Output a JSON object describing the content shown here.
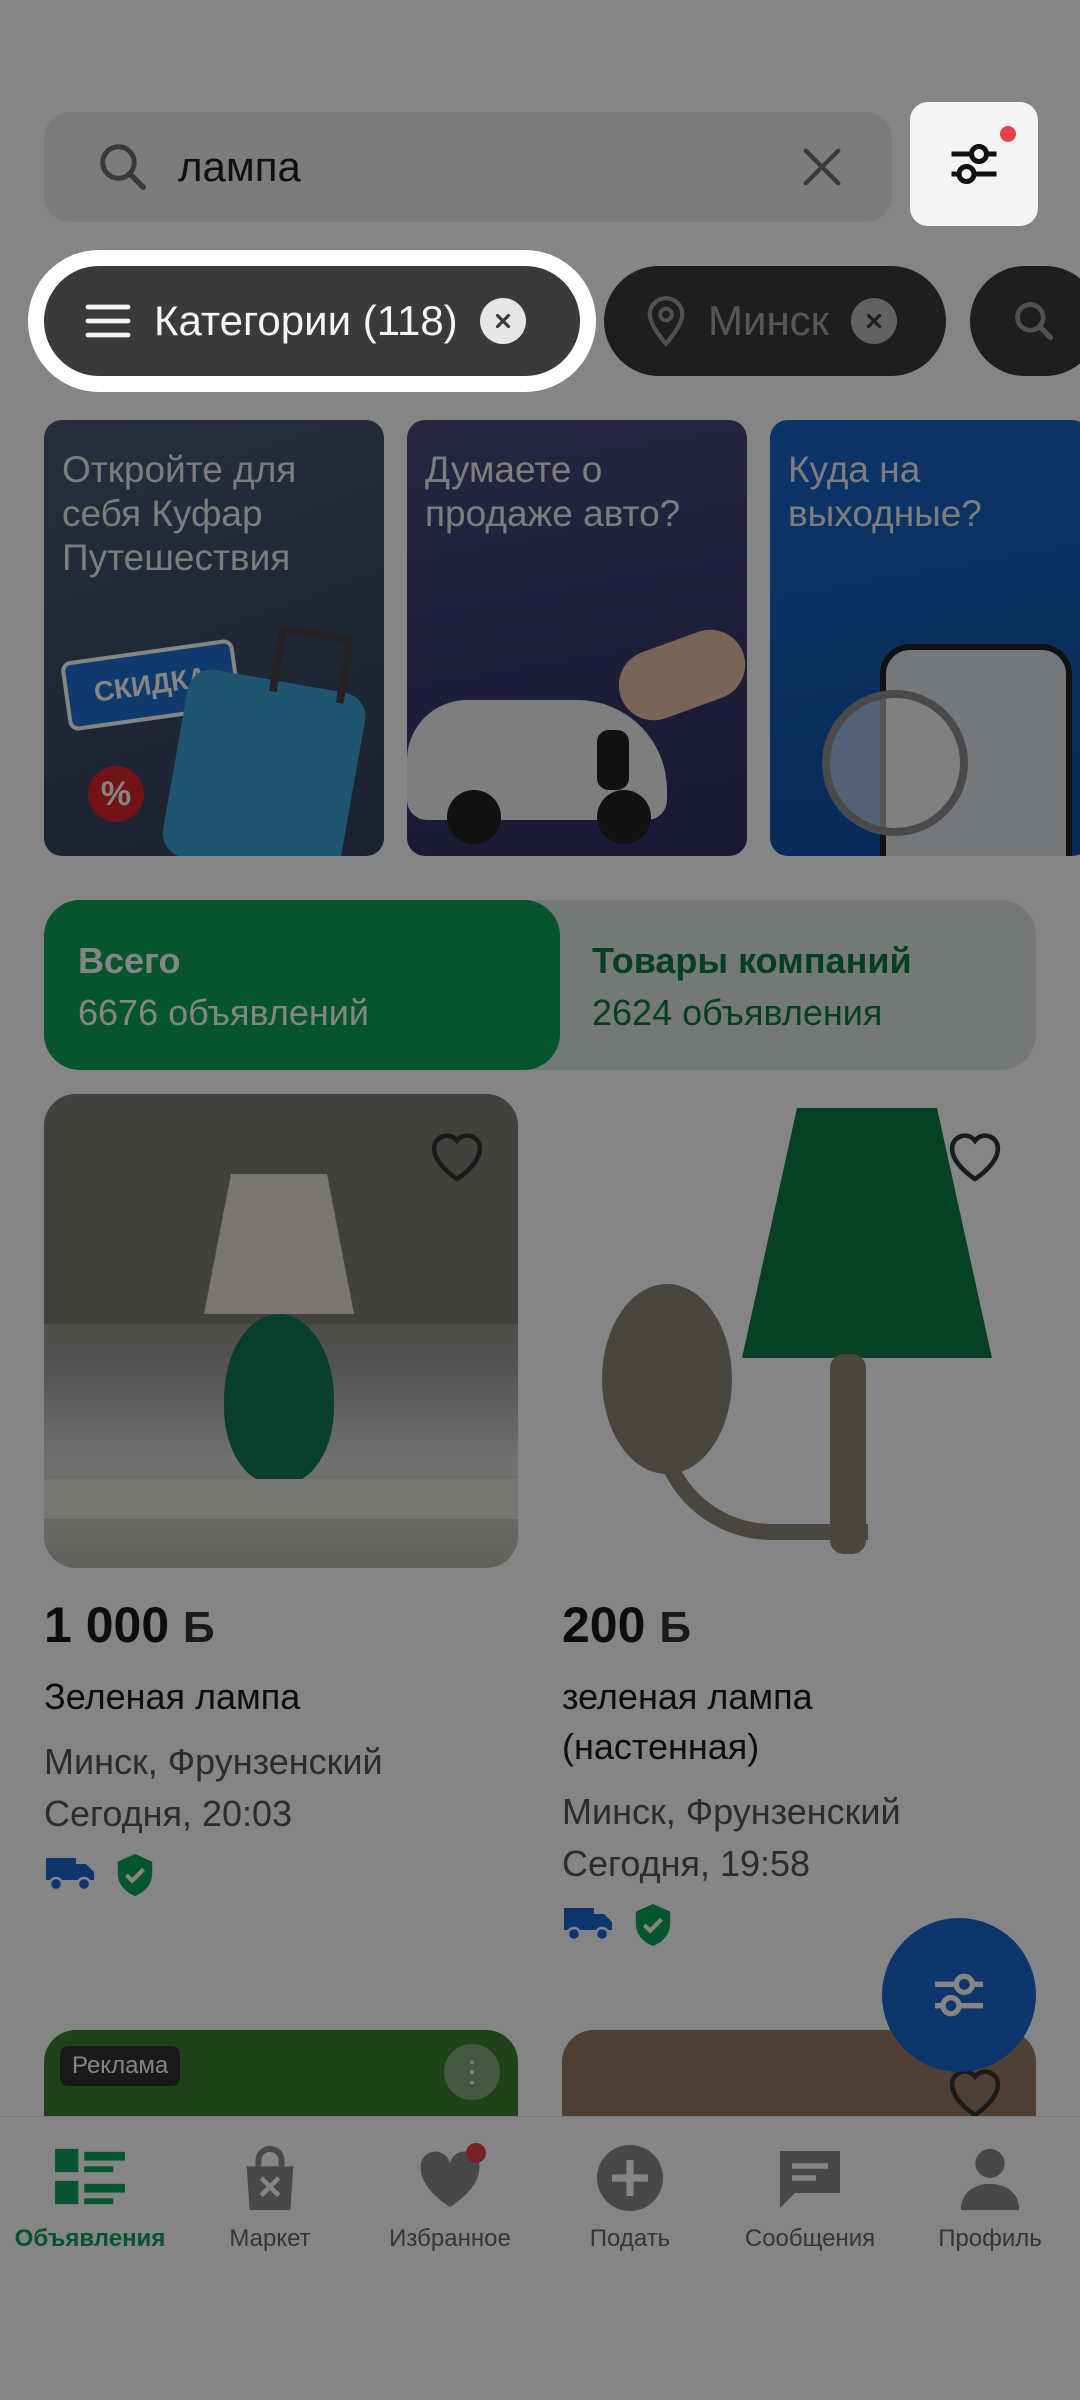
{
  "search": {
    "query": "лампа"
  },
  "chips": {
    "categories": "Категории (118)",
    "city": "Минск"
  },
  "promos": [
    {
      "text": "Откройте для себя Куфар Путешествия",
      "badge": "СКИДКА"
    },
    {
      "text": "Думаете о продаже авто?"
    },
    {
      "text": "Куда на выходные?"
    }
  ],
  "segment": {
    "left_title": "Всего",
    "left_sub": "6676 объявлений",
    "right_title": "Товары компаний",
    "right_sub": "2624 объявления"
  },
  "listings": [
    {
      "price": "1 000",
      "currency": "Б",
      "title": "Зеленая лампа",
      "location": "Минск, Фрунзенский",
      "time": "Сегодня, 20:03"
    },
    {
      "price": "200",
      "currency": "Б",
      "title_line1": "зеленая лампа",
      "title_line2": "(настенная)",
      "location": "Минск, Фрунзенский",
      "time": "Сегодня, 19:58"
    }
  ],
  "ad": {
    "label": "Реклама"
  },
  "nav": [
    {
      "label": "Объявления",
      "icon": "listings-icon",
      "active": true
    },
    {
      "label": "Маркет",
      "icon": "market-bag-icon"
    },
    {
      "label": "Избранное",
      "icon": "heart-icon"
    },
    {
      "label": "Подать",
      "icon": "plus-circle-icon"
    },
    {
      "label": "Сообщения",
      "icon": "chat-icon"
    },
    {
      "label": "Профиль",
      "icon": "person-icon"
    }
  ],
  "colors": {
    "accent_green": "#0aa35a",
    "fab_blue": "#1769d1",
    "notify_red": "#e8414a"
  }
}
